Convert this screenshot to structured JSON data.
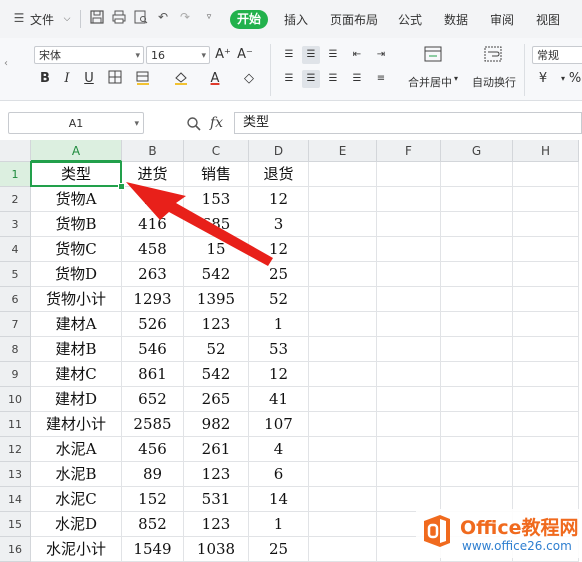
{
  "menubar": {
    "menu_icon": "menu-icon",
    "file_label": "文件",
    "tabs": [
      {
        "label": "开始",
        "active": true
      },
      {
        "label": "插入"
      },
      {
        "label": "页面布局"
      },
      {
        "label": "公式"
      },
      {
        "label": "数据"
      },
      {
        "label": "审阅"
      },
      {
        "label": "视图"
      }
    ]
  },
  "ribbon": {
    "font_name": "宋体",
    "font_size": "16",
    "bold": "B",
    "italic": "I",
    "underline": "U",
    "font_color_letter": "A",
    "grow_font": "A⁺",
    "shrink_font": "A⁻",
    "merge_center_label": "合并居中",
    "wrap_text_label": "自动换行",
    "number_format": "常规",
    "currency_symbol": "¥",
    "percent_symbol": "%",
    "accent_font_color": "#e03b2c",
    "accent_fill_color": "#f2c231"
  },
  "formula_bar": {
    "name_box": "A1",
    "fx_label": "fx",
    "content": "类型"
  },
  "sheet": {
    "columns": [
      "A",
      "B",
      "C",
      "D",
      "E",
      "F",
      "G",
      "H"
    ],
    "active_column": "A",
    "active_row": "1",
    "rows": [
      {
        "num": "1",
        "cells": [
          "类型",
          "进货",
          "销售",
          "退货"
        ]
      },
      {
        "num": "2",
        "cells": [
          "货物A",
          "13",
          "153",
          "12"
        ]
      },
      {
        "num": "3",
        "cells": [
          "货物B",
          "416",
          "685",
          "3"
        ]
      },
      {
        "num": "4",
        "cells": [
          "货物C",
          "458",
          "15",
          "12"
        ]
      },
      {
        "num": "5",
        "cells": [
          "货物D",
          "263",
          "542",
          "25"
        ]
      },
      {
        "num": "6",
        "cells": [
          "货物小计",
          "1293",
          "1395",
          "52"
        ]
      },
      {
        "num": "7",
        "cells": [
          "建材A",
          "526",
          "123",
          "1"
        ]
      },
      {
        "num": "8",
        "cells": [
          "建材B",
          "546",
          "52",
          "53"
        ]
      },
      {
        "num": "9",
        "cells": [
          "建材C",
          "861",
          "542",
          "12"
        ]
      },
      {
        "num": "10",
        "cells": [
          "建材D",
          "652",
          "265",
          "41"
        ]
      },
      {
        "num": "11",
        "cells": [
          "建材小计",
          "2585",
          "982",
          "107"
        ]
      },
      {
        "num": "12",
        "cells": [
          "水泥A",
          "456",
          "261",
          "4"
        ]
      },
      {
        "num": "13",
        "cells": [
          "水泥B",
          "89",
          "123",
          "6"
        ]
      },
      {
        "num": "14",
        "cells": [
          "水泥C",
          "152",
          "531",
          "14"
        ]
      },
      {
        "num": "15",
        "cells": [
          "水泥D",
          "852",
          "123",
          "1"
        ]
      },
      {
        "num": "16",
        "cells": [
          "水泥小计",
          "1549",
          "1038",
          "25"
        ]
      }
    ]
  },
  "annotation": {
    "arrow_color": "#e8201a",
    "arrow_icon": "red-arrow-pointer"
  },
  "watermark": {
    "title": "Office教程网",
    "url": "www.office26.com",
    "logo_icon": "office-logo-icon",
    "brand_color": "#f06a1e",
    "url_color": "#2f7fd0"
  }
}
